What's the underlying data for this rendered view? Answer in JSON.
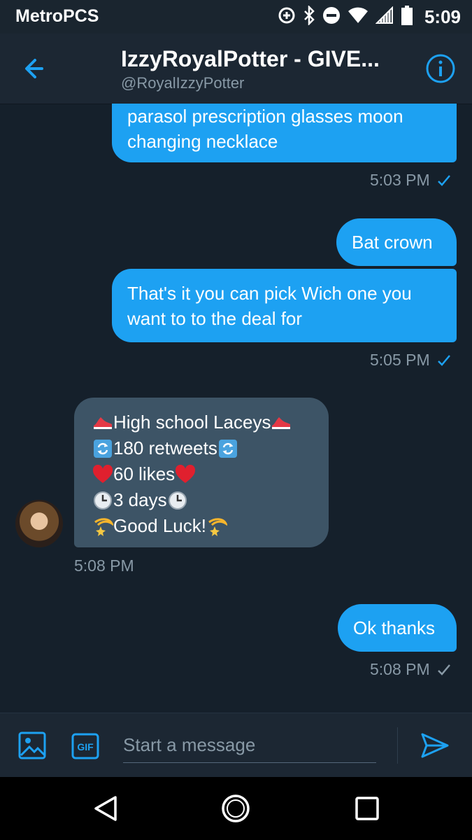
{
  "status_bar": {
    "carrier": "MetroPCS",
    "time": "5:09",
    "icons": [
      "data-saver-icon",
      "bluetooth-icon",
      "do-not-disturb-icon",
      "wifi-icon",
      "signal-icon",
      "battery-icon"
    ]
  },
  "header": {
    "title": "IzzyRoyalPotter - GIVE...",
    "handle": "@RoyalIzzyPotter"
  },
  "messages": [
    {
      "direction": "sent",
      "lines": [
        "parasol  prescription glasses  moon",
        "changing necklace"
      ],
      "timestamp": "5:03 PM"
    },
    {
      "direction": "sent",
      "lines": [
        "Bat crown"
      ]
    },
    {
      "direction": "sent",
      "lines": [
        "That's it you can pick Wich one you",
        "want to to the deal for"
      ],
      "timestamp": "5:05 PM"
    },
    {
      "direction": "received",
      "lines": [
        {
          "text": "High school Laceys",
          "emoji": "sneaker"
        },
        {
          "text": "180 retweets",
          "emoji": "repeat"
        },
        {
          "text": "60 likes",
          "emoji": "heart"
        },
        {
          "text": "3 days",
          "emoji": "clock"
        },
        {
          "text": "Good Luck!",
          "emoji": "dizzy-star"
        }
      ],
      "timestamp": "5:08 PM"
    },
    {
      "direction": "sent",
      "lines": [
        "Ok thanks"
      ],
      "timestamp": "5:08 PM"
    }
  ],
  "composer": {
    "placeholder": "Start a message",
    "gif_label": "GIF"
  },
  "colors": {
    "background": "#15202b",
    "header": "#1c2733",
    "sent_bubble": "#1da1f2",
    "received_bubble": "#3d5466",
    "muted_text": "#8899a6",
    "accent": "#1da1f2"
  }
}
